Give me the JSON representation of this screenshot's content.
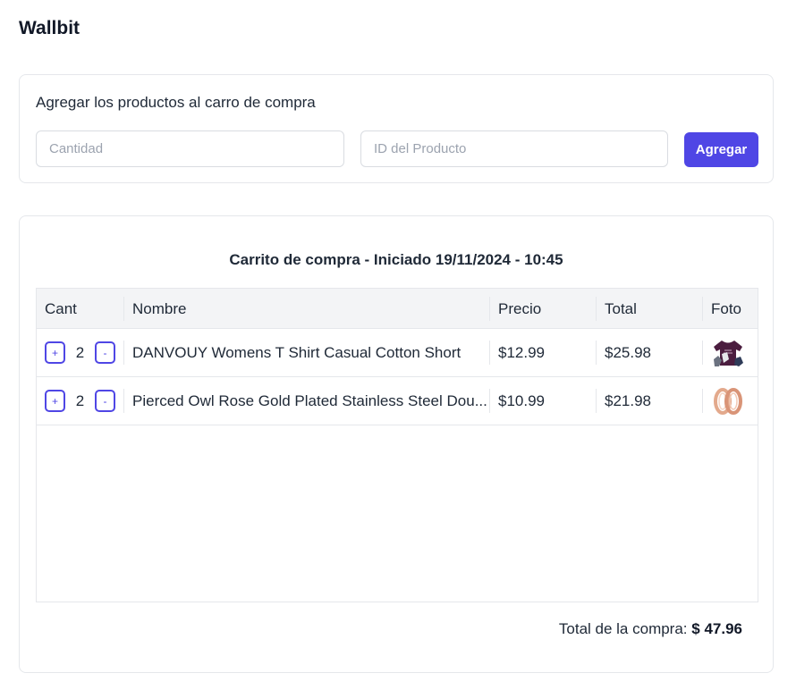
{
  "app": {
    "brand": "Wallbit"
  },
  "add_form": {
    "title": "Agregar los productos al carro de compra",
    "quantity_placeholder": "Cantidad",
    "product_id_placeholder": "ID del Producto",
    "add_label": "Agregar"
  },
  "cart": {
    "title": "Carrito de compra - Iniciado 19/11/2024 - 10:45",
    "columns": [
      "Cant",
      "Nombre",
      "Precio",
      "Total",
      "Foto"
    ],
    "increment_label": "+",
    "decrement_label": "-",
    "rows": [
      {
        "qty": "2",
        "name": "DANVOUY Womens T Shirt Casual Cotton Short",
        "price": "$12.99",
        "total": "$25.98",
        "photo": "purple-tshirt"
      },
      {
        "qty": "2",
        "name": "Pierced Owl Rose Gold Plated Stainless Steel Dou...",
        "price": "$10.99",
        "total": "$21.98",
        "photo": "rose-gold-earrings"
      }
    ],
    "grand_total_label": "Total de la compra:",
    "grand_total_value": "$ 47.96"
  },
  "colors": {
    "accent": "#4f46e5",
    "header_bg": "#f3f4f6",
    "border": "#e5e7eb"
  }
}
